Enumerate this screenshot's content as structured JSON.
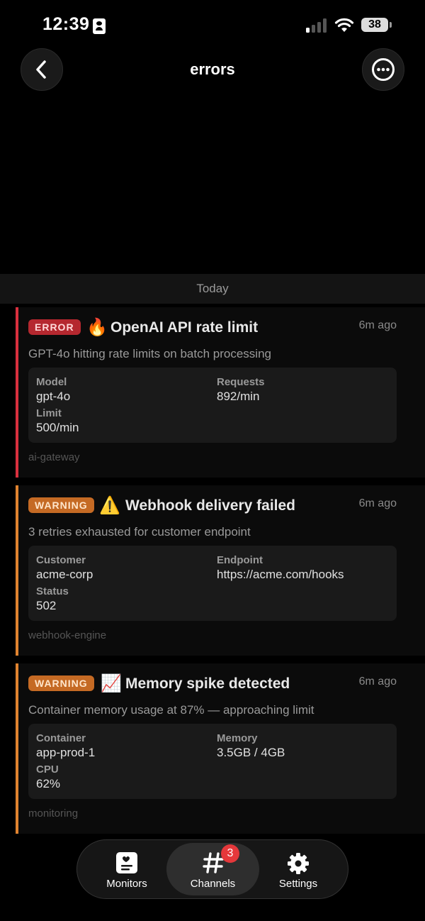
{
  "status_bar": {
    "time": "12:39",
    "battery": "38",
    "icons": [
      "id-card-icon",
      "cellular-signal-icon",
      "wifi-icon",
      "battery-icon"
    ]
  },
  "nav": {
    "title": "errors",
    "back_icon": "chevron-left-icon",
    "more_icon": "ellipsis-circle-icon"
  },
  "date_separator": "Today",
  "alerts": [
    {
      "level": "ERROR",
      "emoji": "🔥",
      "title": "OpenAI API rate limit",
      "time_ago": "6m ago",
      "description": "GPT-4o hitting rate limits on batch processing",
      "fields": [
        {
          "label": "Model",
          "value": "gpt-4o"
        },
        {
          "label": "Requests",
          "value": "892/min"
        },
        {
          "label": "Limit",
          "value": "500/min"
        }
      ],
      "source": "ai-gateway"
    },
    {
      "level": "WARNING",
      "emoji": "⚠️",
      "title": "Webhook delivery failed",
      "time_ago": "6m ago",
      "description": "3 retries exhausted for customer endpoint",
      "fields": [
        {
          "label": "Customer",
          "value": "acme-corp"
        },
        {
          "label": "Endpoint",
          "value": "https://acme.com/hooks"
        },
        {
          "label": "Status",
          "value": "502"
        }
      ],
      "source": "webhook-engine"
    },
    {
      "level": "WARNING",
      "emoji": "📈",
      "title": "Memory spike detected",
      "time_ago": "6m ago",
      "description": "Container memory usage at 87% — approaching limit",
      "fields": [
        {
          "label": "Container",
          "value": "app-prod-1"
        },
        {
          "label": "Memory",
          "value": "3.5GB / 4GB"
        },
        {
          "label": "CPU",
          "value": "62%"
        }
      ],
      "source": "monitoring"
    }
  ],
  "tabs": [
    {
      "label": "Monitors",
      "icon": "monitors-icon"
    },
    {
      "label": "Channels",
      "icon": "hash-icon",
      "badge": "3",
      "active": true
    },
    {
      "label": "Settings",
      "icon": "gear-icon"
    }
  ],
  "colors": {
    "error_accent": "#d9303e",
    "warning_accent": "#e0832f",
    "badge_count": "#e5383b"
  }
}
